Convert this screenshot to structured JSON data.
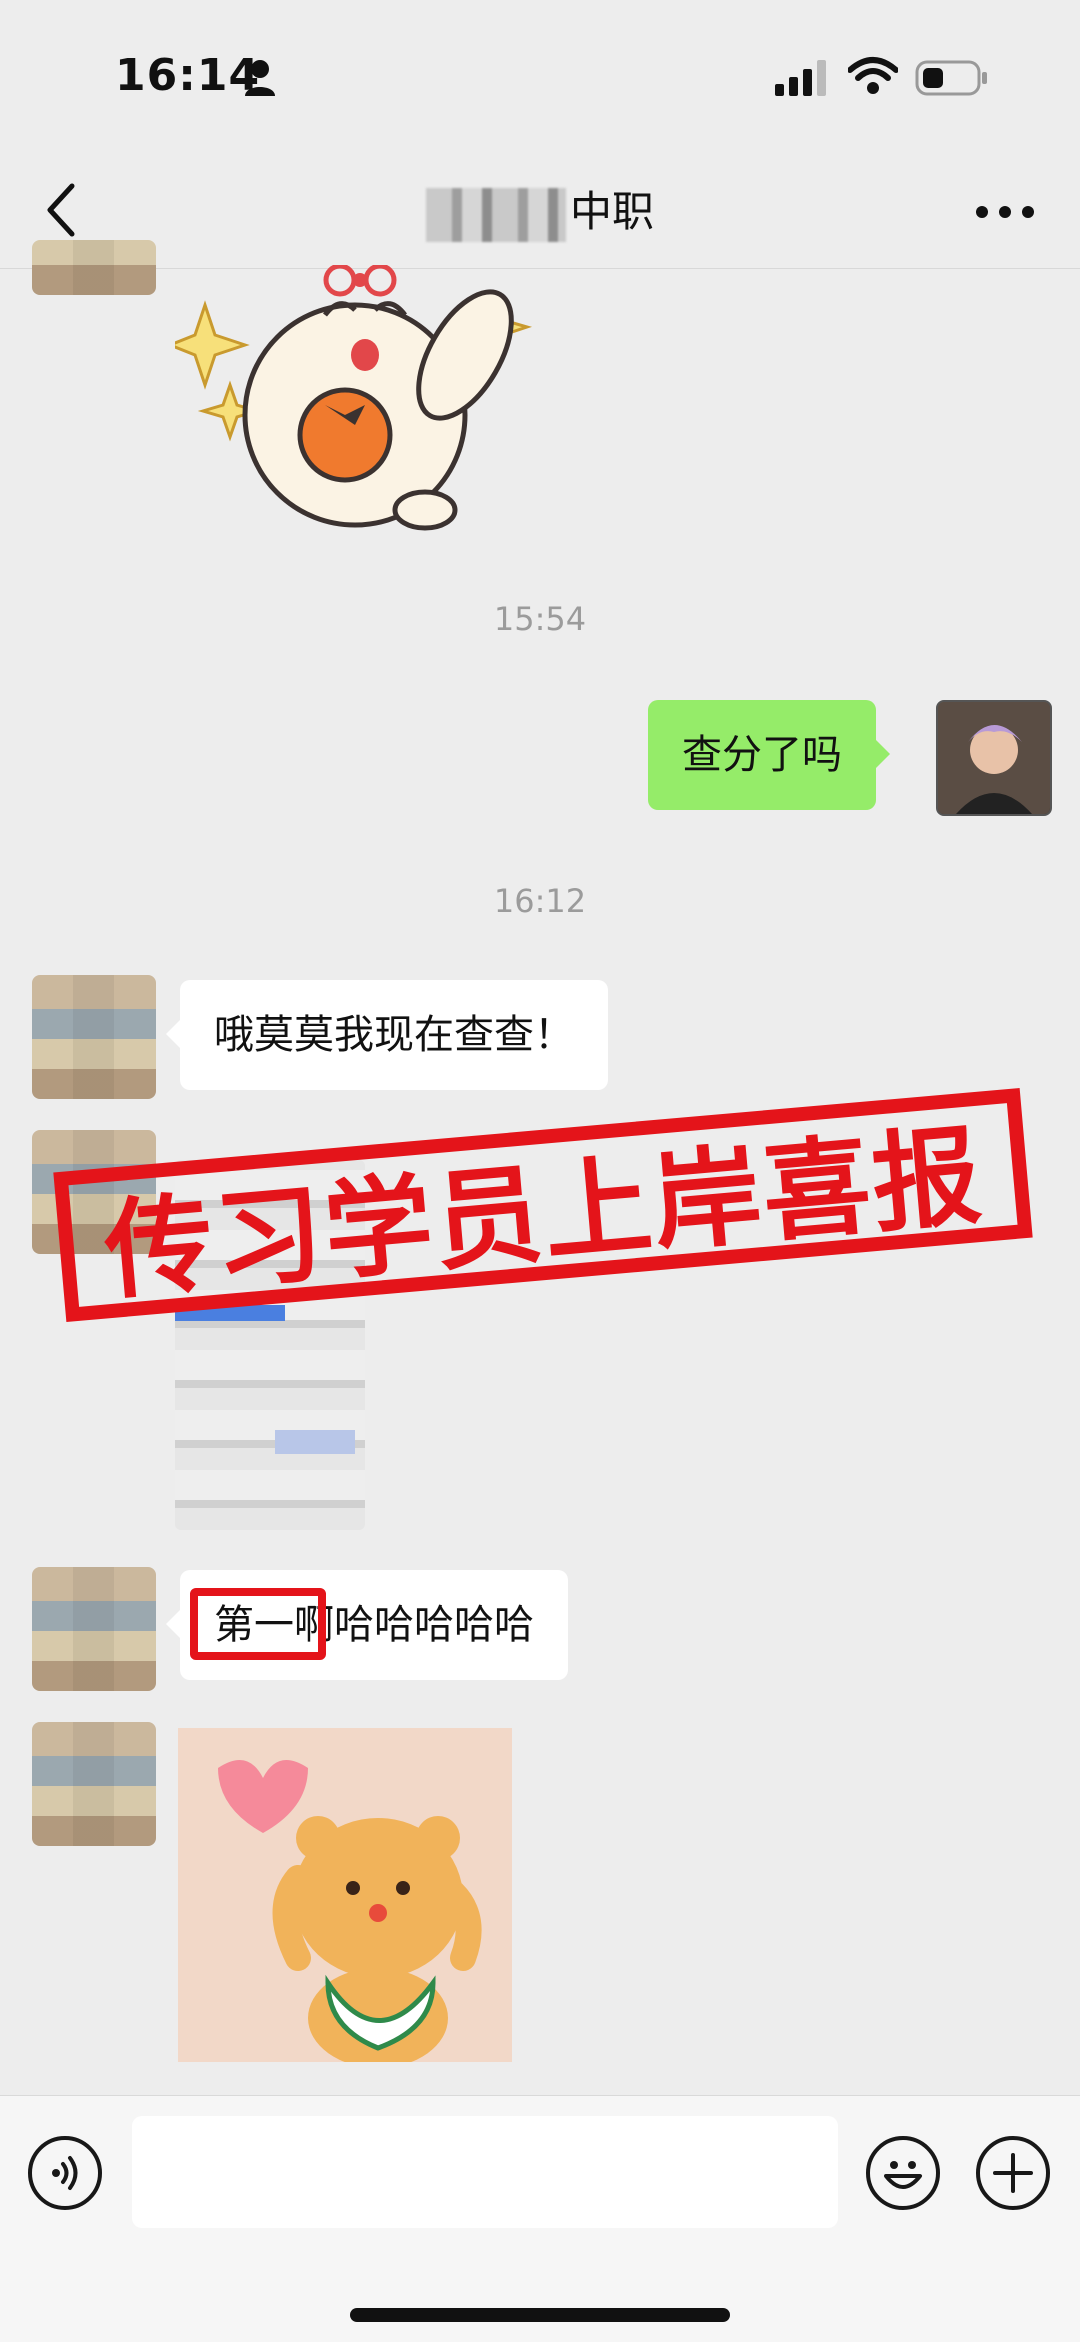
{
  "status_bar": {
    "time": "16:14",
    "icons": [
      "person-icon",
      "signal-icon",
      "wifi-icon",
      "battery-icon"
    ]
  },
  "header": {
    "title_suffix": "中职",
    "back_icon": "chevron-left-icon",
    "more_icon": "ellipsis-icon"
  },
  "messages": {
    "timestamp_1": "15:54",
    "outgoing_1": "查分了吗",
    "timestamp_2": "16:12",
    "incoming_1": "哦莫莫我现在查查！",
    "incoming_2": "第一啊哈哈哈哈哈"
  },
  "overlay": {
    "stamp_text": "传习学员上岸喜报",
    "stamp_color": "#e4141a"
  },
  "input_bar": {
    "placeholder": "",
    "icons": [
      "voice-icon",
      "emoji-icon",
      "plus-icon"
    ]
  },
  "colors": {
    "background": "#ededed",
    "outgoing_bubble": "#95ec69",
    "incoming_bubble": "#ffffff",
    "timestamp": "#9b9b9b"
  }
}
